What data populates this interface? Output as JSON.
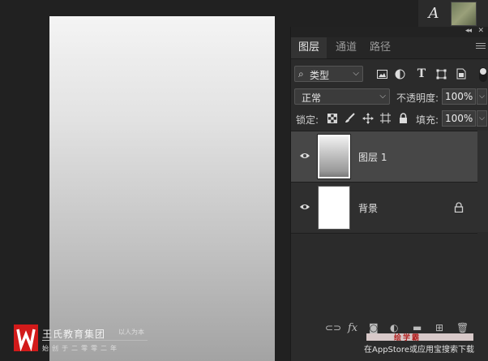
{
  "dock": {
    "char_panel_glyph": "A"
  },
  "panel": {
    "collapse_glyph": "◂◂",
    "close_glyph": "✕",
    "tabs": [
      {
        "label": "图层",
        "active": true
      },
      {
        "label": "通道",
        "active": false
      },
      {
        "label": "路径",
        "active": false
      }
    ],
    "filter": {
      "label": "类型",
      "icons": [
        "image-filter-icon",
        "adjustment-filter-icon",
        "type-filter-icon",
        "shape-filter-icon",
        "smart-object-filter-icon"
      ]
    },
    "blend_mode": "正常",
    "opacity_label": "不透明度:",
    "opacity_value": "100%",
    "lock_label": "锁定:",
    "fill_label": "填充:",
    "fill_value": "100%",
    "layers": [
      {
        "name": "图层 1",
        "visible": true,
        "selected": true,
        "locked": false
      },
      {
        "name": "背景",
        "visible": true,
        "selected": false,
        "locked": true
      }
    ],
    "bottom_icons": [
      "link-icon",
      "fx-icon",
      "mask-icon",
      "adjustment-icon",
      "group-icon",
      "new-layer-icon",
      "trash-icon"
    ],
    "fx_label": "fx"
  },
  "logo": {
    "title": "王氏教育集团",
    "slogan": "以人为本",
    "subtitle": "始创于二零零二年",
    "color": "#d21a1a"
  },
  "watermark": {
    "brand": "绘学霸",
    "text": "在AppStore或应用宝搜索下载"
  }
}
